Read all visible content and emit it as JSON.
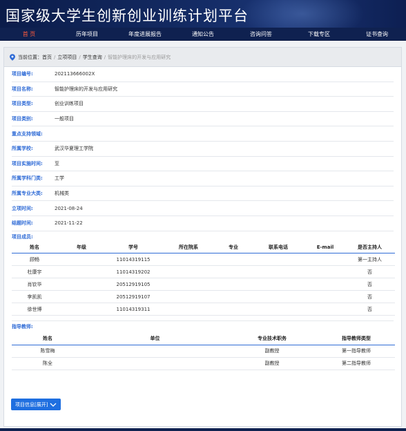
{
  "header": {
    "title": "国家级大学生创新创业训练计划平台"
  },
  "nav": {
    "items": [
      "首 页",
      "历年项目",
      "年度进展报告",
      "通知公告",
      "咨询问答",
      "下载专区",
      "证书查询"
    ],
    "active_index": 0,
    "active_color": "#ff5a3c",
    "bg_color": "#0f2150"
  },
  "breadcrumb": {
    "prefix": "当前位置：",
    "home": "首页",
    "level1": "立项项目",
    "level2": "学生查询",
    "current": "智能护理床的开发与应用研究",
    "separator": "/"
  },
  "info": [
    {
      "label": "项目编号:",
      "value": "202113666002X"
    },
    {
      "label": "项目名称:",
      "value": "智能护理床的开发与应用研究"
    },
    {
      "label": "项目类型:",
      "value": "创业训练项目"
    },
    {
      "label": "项目类别:",
      "value": "一般项目"
    },
    {
      "label": "重点支持领域:",
      "value": ""
    },
    {
      "label": "所属学校:",
      "value": "武汉华夏理工学院"
    },
    {
      "label": "项目实施时间:",
      "value": "至"
    },
    {
      "label": "所属学科门类:",
      "value": "工学"
    },
    {
      "label": "所属专业大类:",
      "value": "机械类"
    },
    {
      "label": "立项时间:",
      "value": "2021-08-24"
    },
    {
      "label": "结题时间:",
      "value": "2021-11-22"
    }
  ],
  "members": {
    "section_label": "项目成员:",
    "headers": [
      "姓名",
      "年级",
      "学号",
      "所在院系",
      "专业",
      "联系电话",
      "E-mail",
      "是否主持人"
    ],
    "rows": [
      [
        "顾畅",
        "",
        "11014319115",
        "",
        "",
        "",
        "",
        "第一主持人"
      ],
      [
        "杜康宇",
        "",
        "11014319202",
        "",
        "",
        "",
        "",
        "否"
      ],
      [
        "肖钦华",
        "",
        "20512919105",
        "",
        "",
        "",
        "",
        "否"
      ],
      [
        "李凯凯",
        "",
        "20512919107",
        "",
        "",
        "",
        "",
        "否"
      ],
      [
        "徐世博",
        "",
        "11014319311",
        "",
        "",
        "",
        "",
        "否"
      ]
    ]
  },
  "advisors": {
    "section_label": "指导教师:",
    "headers": [
      "姓名",
      "单位",
      "专业技术职务",
      "指导教师类型"
    ],
    "rows": [
      [
        "陈雪梅",
        "",
        "副教授",
        "第一指导教师"
      ],
      [
        "陈全",
        "",
        "副教授",
        "第二指导教师"
      ]
    ]
  },
  "expand_button": {
    "label": "项目信息[展开]",
    "icon": "chevron-down-icon"
  },
  "accent_color": "#2f6bd6",
  "button_color": "#1f6fe0"
}
